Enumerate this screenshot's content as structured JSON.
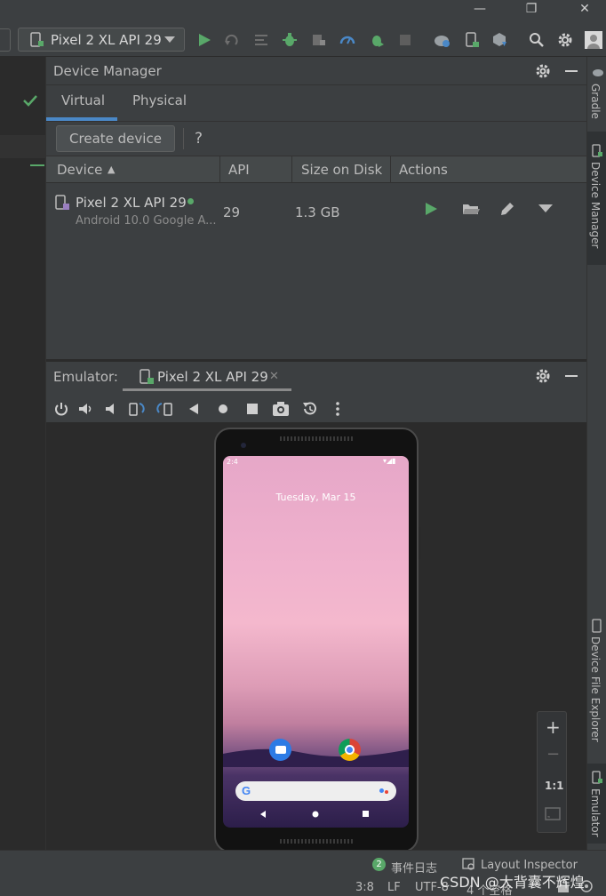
{
  "window": {
    "minimize": "—",
    "restore": "❐",
    "close": "✕"
  },
  "toolbar": {
    "device_selector": "Pixel 2 XL API 29"
  },
  "device_manager": {
    "title": "Device Manager",
    "tabs": [
      {
        "label": "Virtual",
        "active": true
      },
      {
        "label": "Physical",
        "active": false
      }
    ],
    "create_device": "Create device",
    "help": "?",
    "columns": [
      "Device",
      "API",
      "Size on Disk",
      "Actions"
    ],
    "sort_indicator": "▲",
    "rows": [
      {
        "name": "Pixel 2 XL API 29",
        "subtitle": "Android 10.0 Google A...",
        "api": "29",
        "size": "1.3 GB",
        "online": true
      }
    ]
  },
  "emulator": {
    "title": "Emulator:",
    "tab_label": "Pixel 2 XL API 29",
    "phone": {
      "status_left": "2:4",
      "status_right": "▾◢▮",
      "date": "Tuesday, Mar 15"
    },
    "zoom": {
      "in": "+",
      "out": "−",
      "one_to_one": "1:1"
    }
  },
  "right_stripe": [
    "Gradle",
    "Device Manager",
    "Device File Explorer",
    "Emulator"
  ],
  "statusbar": {
    "event_count": "2",
    "event_log": "事件日志",
    "layout_inspector": "Layout Inspector",
    "position": "3:8",
    "line_sep": "LF",
    "encoding": "UTF-8",
    "indent": "4 个空格",
    "watermark": "CSDN @大背囊不辉煌"
  },
  "colors": {
    "accent": "#4a88c7",
    "run_green": "#59a869",
    "bg": "#3c3f41",
    "dark": "#2b2b2b"
  }
}
